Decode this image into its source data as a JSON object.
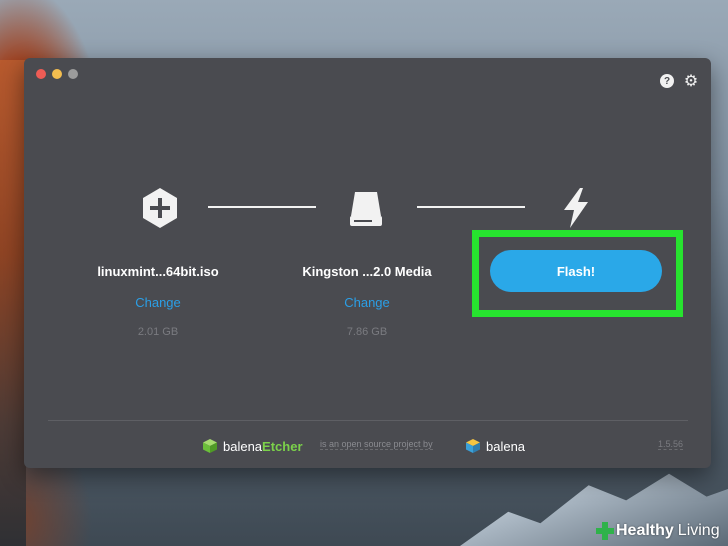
{
  "app": {
    "name": "balenaEtcher"
  },
  "steps": [
    {
      "label": "linuxmint...64bit.iso",
      "change": "Change",
      "size": "2.01 GB",
      "icon": "plus-hexagon-icon"
    },
    {
      "label": "Kingston ...2.0 Media",
      "change": "Change",
      "size": "7.86 GB",
      "icon": "drive-icon"
    },
    {
      "label": "",
      "icon": "lightning-icon"
    }
  ],
  "flash": {
    "label": "Flash!"
  },
  "footer": {
    "brand_a": "balena",
    "brand_b": "Etcher",
    "middle": "is an open source project by",
    "balena": "balena",
    "version": "1.5.56"
  },
  "toolbar": {
    "help": "?",
    "help_icon": "help-icon",
    "settings_icon": "gear-icon"
  },
  "watermark": {
    "part_a": "Healthy",
    "part_b": "Living"
  },
  "colors": {
    "window_bg": "#4a4b50",
    "accent": "#2aa8e8",
    "link": "#2b9fe6",
    "highlight": "#27e32f",
    "etcher_green": "#7bd14a"
  }
}
